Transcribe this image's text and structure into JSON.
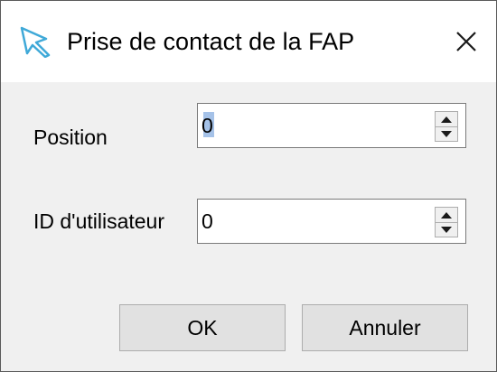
{
  "window": {
    "title": "Prise de contact de la FAP",
    "close_glyph": "✕"
  },
  "form": {
    "position": {
      "label": "Position",
      "value": "0"
    },
    "user_id": {
      "label": "ID d'utilisateur",
      "value": "0"
    }
  },
  "buttons": {
    "ok_label": "OK",
    "cancel_label": "Annuler"
  },
  "icons": {
    "app_icon": "pointer-arrow-icon",
    "close_icon": "close-icon",
    "spin_up": "spin-up-icon",
    "spin_down": "spin-down-icon"
  },
  "colors": {
    "window_bg": "#f0f0f0",
    "titlebar_bg": "#ffffff",
    "accent": "#3fa9d8",
    "button_bg": "#e1e1e1"
  }
}
